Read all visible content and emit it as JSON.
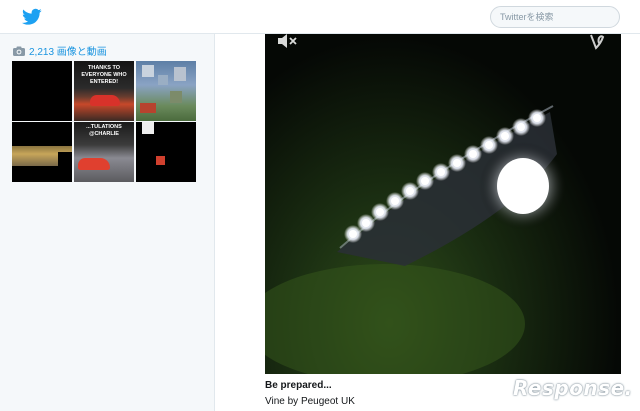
{
  "header": {
    "logo_icon": "bird-icon",
    "search_placeholder": "Twitterを検索"
  },
  "sidebar": {
    "media_count_text": "2,213 画像と動画",
    "media_icon": "camera-icon",
    "thumbnails": [
      {
        "label": ""
      },
      {
        "label": "THANKS TO EVERYONE WHO ENTERED!"
      },
      {
        "label": ""
      },
      {
        "label": ""
      },
      {
        "label": "...TULATIONS @CHARLIE"
      },
      {
        "label": ""
      }
    ]
  },
  "tweet": {
    "title": "Be prepared...",
    "attribution": "Vine by Peugeot UK",
    "mute_icon": "speaker-mute-icon",
    "vine_icon": "vine-logo-icon"
  },
  "watermark": {
    "text": "Response."
  }
}
